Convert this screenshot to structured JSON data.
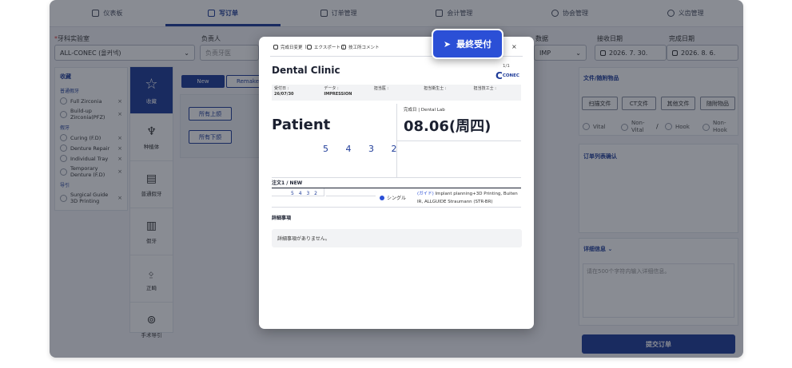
{
  "nav": {
    "items": [
      {
        "label": "仪表板",
        "icon": "dashboard-icon"
      },
      {
        "label": "写订单",
        "icon": "edit-icon"
      },
      {
        "label": "订单管理",
        "icon": "box-icon"
      },
      {
        "label": "会计管理",
        "icon": "card-icon"
      },
      {
        "label": "协会管理",
        "icon": "person-icon"
      },
      {
        "label": "义齿管理",
        "icon": "tooth-icon"
      }
    ]
  },
  "form": {
    "lab_label": "牙科实验室",
    "lab_value": "ALL-CONEC (올커넥)",
    "manager_label": "负责人",
    "manager_placeholder": "负责牙医",
    "type_label": "数据",
    "type_value": "IMP",
    "receive_label": "接收日期",
    "receive_value": "2026. 7. 30.",
    "complete_label": "完成日期",
    "complete_value": "2026. 8. 6."
  },
  "favorites": {
    "title": "收藏",
    "groups": [
      {
        "name": "普通假牙",
        "items": [
          "Full Zirconia",
          "Build-up Zirconia(PFZ)"
        ]
      },
      {
        "name": "假牙",
        "items": [
          "Curing (F.D)",
          "Denture Repair",
          "Individual Tray",
          "Temporary Denture (F.D)"
        ]
      },
      {
        "name": "导引",
        "items": [
          "Surgical Guide 3D Printing"
        ]
      }
    ]
  },
  "categories": [
    {
      "label": "收藏",
      "icon": "star-icon"
    },
    {
      "label": "种植体",
      "icon": "implant-icon"
    },
    {
      "label": "普通假牙",
      "icon": "crown-icon"
    },
    {
      "label": "假牙",
      "icon": "denture-icon"
    },
    {
      "label": "正畸",
      "icon": "ortho-icon"
    },
    {
      "label": "手术导引",
      "icon": "guide-icon"
    }
  ],
  "tabs": {
    "new": "New",
    "remake": "Remake"
  },
  "jaw": {
    "upper": "所有上颌",
    "lower": "所有下颌"
  },
  "files": {
    "title": "文件/随附物品",
    "buttons": [
      "扫描文件",
      "CT文件",
      "其他文件",
      "随附物品"
    ],
    "checks": [
      "Vital",
      "Non-Vital",
      "Hook",
      "Non-Hook"
    ],
    "separator": "/"
  },
  "confirm": {
    "title": "订单列表确认"
  },
  "details": {
    "title": "详细信息",
    "placeholder": "请在500个字符内输入详细信息。"
  },
  "submit_label": "提交订单",
  "modal": {
    "tools": [
      "完成日变更",
      "エクスポート",
      "技工所コメント"
    ],
    "close": "×",
    "page": "1/1",
    "clinic": "Dental Clinic",
    "logo": "CONEC",
    "info": [
      {
        "label": "受付日 :",
        "value": "26/07/30"
      },
      {
        "label": "データ :",
        "value": "IMPRESSION"
      },
      {
        "label": "担当医 :",
        "value": ""
      },
      {
        "label": "担当衛生士 :",
        "value": ""
      },
      {
        "label": "担当技工士 :",
        "value": ""
      }
    ],
    "patient": "Patient",
    "complete_label": "完成日 | Dental Lab",
    "complete_date": "08.06(周四)",
    "teeth": "5 4 3 2",
    "order_label": "注文1 / NEW",
    "order_teeth": "5 4 3 2",
    "order_type": "シングル",
    "order_desc_guide": "(ガイド)",
    "order_desc": "Implant planning+3D Printing, Buiten IR, ALLGUIDE Straumann (STR-BR)",
    "detail_title": "詳細事項",
    "detail_empty": "詳細事項がありません。"
  },
  "final_button": "最終受付",
  "colors": {
    "brand": "#1f3c99",
    "accent": "#2b4fd6"
  }
}
